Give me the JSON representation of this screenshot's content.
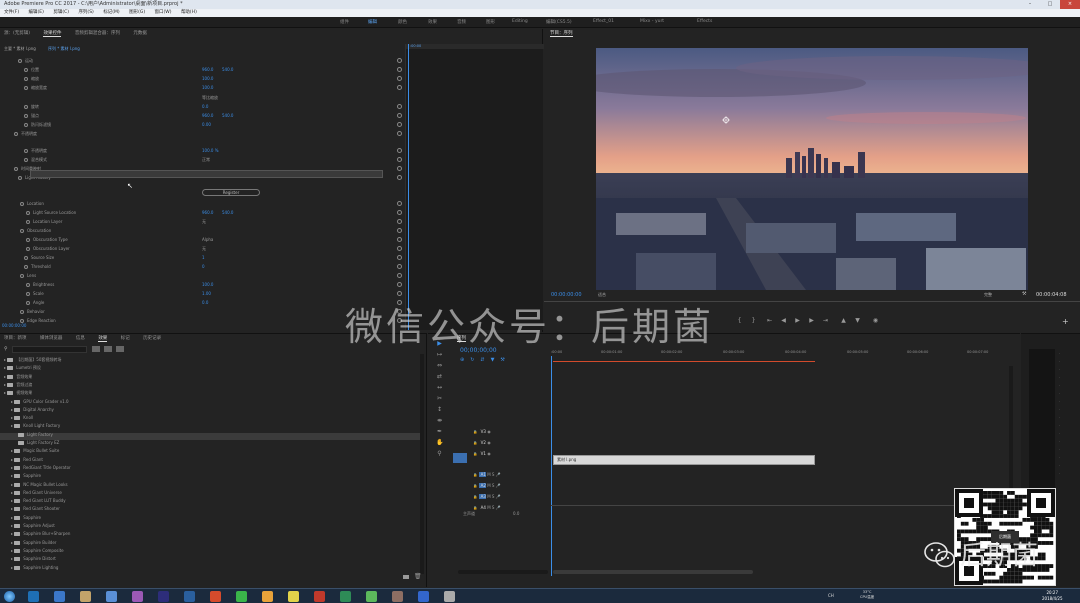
{
  "window": {
    "title": "Adobe Premiere Pro CC 2017 - C:\\用户\\Administrator\\桌面\\新项目.prproj *"
  },
  "menu": [
    "文件(F)",
    "编辑(E)",
    "剪辑(C)",
    "序列(S)",
    "标记(M)",
    "图形(G)",
    "窗口(W)",
    "帮助(H)"
  ],
  "workspaces": [
    "组件",
    "编辑",
    "颜色",
    "效果",
    "音频",
    "图形",
    "Editing",
    "编辑(CS5.5)",
    "Effect_01",
    "Mixx - yurt",
    "Effects"
  ],
  "effect_controls": {
    "tabs": [
      "源：(无剪辑)",
      "效果控件",
      "音频剪辑混合器：序列",
      "元数据"
    ],
    "clip_path": "主要 * 素材 l.png",
    "sequence_path": "序列 * 素材 l.png",
    "rows": [
      {
        "label": "运动",
        "v1": "",
        "v2": ""
      },
      {
        "label": "位置",
        "v1": "960.0",
        "v2": "540.0"
      },
      {
        "label": "缩放",
        "v1": "100.0",
        "v2": ""
      },
      {
        "label": "缩放宽度",
        "v1": "100.0",
        "v2": ""
      },
      {
        "label": "",
        "v1": "等比缩放",
        "v2": ""
      },
      {
        "label": "旋转",
        "v1": "0.0",
        "v2": ""
      },
      {
        "label": "锚点",
        "v1": "960.0",
        "v2": "540.0"
      },
      {
        "label": "防闪烁滤镜",
        "v1": "0.00",
        "v2": ""
      },
      {
        "label": "不透明度",
        "v1": "",
        "v2": ""
      },
      {
        "label": "不透明度",
        "v1": "100.0 %",
        "v2": ""
      },
      {
        "label": "混合模式",
        "v1": "正常",
        "v2": ""
      },
      {
        "label": "时间重映射",
        "v1": "",
        "v2": ""
      },
      {
        "label": "Light Factory",
        "v1": "",
        "v2": ""
      },
      {
        "label": "",
        "v1": "Register",
        "v2": ""
      },
      {
        "label": "Location",
        "v1": "",
        "v2": ""
      },
      {
        "label": "Light Source Location",
        "v1": "960.0",
        "v2": "540.0"
      },
      {
        "label": "Location Layer",
        "v1": "无",
        "v2": ""
      },
      {
        "label": "Obscuration",
        "v1": "",
        "v2": ""
      },
      {
        "label": "Obscuration Type",
        "v1": "Alpha",
        "v2": ""
      },
      {
        "label": "Obscuration Layer",
        "v1": "无",
        "v2": ""
      },
      {
        "label": "Source Size",
        "v1": "1",
        "v2": ""
      },
      {
        "label": "Threshold",
        "v1": "0",
        "v2": ""
      },
      {
        "label": "Lens",
        "v1": "",
        "v2": ""
      },
      {
        "label": "Brightness",
        "v1": "100.0",
        "v2": ""
      },
      {
        "label": "Scale",
        "v1": "1.00",
        "v2": ""
      },
      {
        "label": "Angle",
        "v1": "0.0",
        "v2": ""
      },
      {
        "label": "Behavior",
        "v1": "",
        "v2": ""
      },
      {
        "label": "Edge Reaction",
        "v1": "",
        "v2": ""
      }
    ],
    "timecode": "00:00:00:00"
  },
  "program": {
    "tab": "节目：序列",
    "timecode": "00:00:00:00",
    "fit": "适合",
    "quality": "完整",
    "duration": "00:00:04:08"
  },
  "watermark": "微信公众号：后期菌",
  "project_panel": {
    "tabs": [
      "项目：新项",
      "媒体浏览器",
      "信息",
      "效果",
      "标记",
      "历史记录"
    ],
    "items": [
      {
        "label": "【后期菌】50套视频转场",
        "indent": 0
      },
      {
        "label": "Lumetri 预设",
        "indent": 0
      },
      {
        "label": "音频效果",
        "indent": 0
      },
      {
        "label": "音频过渡",
        "indent": 0
      },
      {
        "label": "视频效果",
        "indent": 0
      },
      {
        "label": "GPU Color Grader v1.0",
        "indent": 1
      },
      {
        "label": "Digital Anarchy",
        "indent": 1
      },
      {
        "label": "Knoll",
        "indent": 1
      },
      {
        "label": "Knoll Light Factory",
        "indent": 1
      },
      {
        "label": "Light Factory",
        "indent": 2
      },
      {
        "label": "Light Factory EZ",
        "indent": 2
      },
      {
        "label": "Magic Bullet Suite",
        "indent": 1
      },
      {
        "label": "Red Giant",
        "indent": 1
      },
      {
        "label": "RedGiant Title Operator",
        "indent": 1
      },
      {
        "label": "Sapphire",
        "indent": 1
      },
      {
        "label": "NC Magic Bullet Looks",
        "indent": 1
      },
      {
        "label": "Red Giant Universe",
        "indent": 1
      },
      {
        "label": "Red Giant LUT Buddy",
        "indent": 1
      },
      {
        "label": "Red Giant Shooter",
        "indent": 1
      },
      {
        "label": "Sapphire",
        "indent": 1
      },
      {
        "label": "Sapphire Adjust",
        "indent": 1
      },
      {
        "label": "Sapphire Blur+Sharpen",
        "indent": 1
      },
      {
        "label": "Sapphire Builder",
        "indent": 1
      },
      {
        "label": "Sapphire Composite",
        "indent": 1
      },
      {
        "label": "Sapphire Distort",
        "indent": 1
      },
      {
        "label": "Sapphire Lighting",
        "indent": 1
      }
    ]
  },
  "timeline": {
    "tab": "序列",
    "timecode": "00;00;00;00",
    "ruler": [
      ":00:00",
      "00:00:01:00",
      "00:00:02:00",
      "00:00:03:00",
      "00:00:04:00",
      "00:00:05:00",
      "00:00:06:00",
      "00:00:07:00"
    ],
    "tracks": [
      "V3",
      "V2",
      "V1",
      "A1",
      "A2",
      "A3",
      "A4"
    ],
    "master": "主声道",
    "master_value": "0.0",
    "clip_label": "素材 l.png"
  },
  "taskbar": {
    "time": "20:27",
    "date": "2018/4/25",
    "tray": "CH",
    "temp": "33°C",
    "cpu": "CPU温度",
    "colors": [
      "#1e6fb5",
      "#3b77c9",
      "#c3a36a",
      "#5a8fd6",
      "#9b59b6",
      "#2d2d7a",
      "#2a5f9e",
      "#d64b2c",
      "#3ab54a",
      "#e8a23a",
      "#e1d34a",
      "#c0392b",
      "#2e8b57",
      "#5cb85c",
      "#8d6e63",
      "#3366cc",
      "#aaaaaa"
    ]
  },
  "qr_label": "后期菌"
}
